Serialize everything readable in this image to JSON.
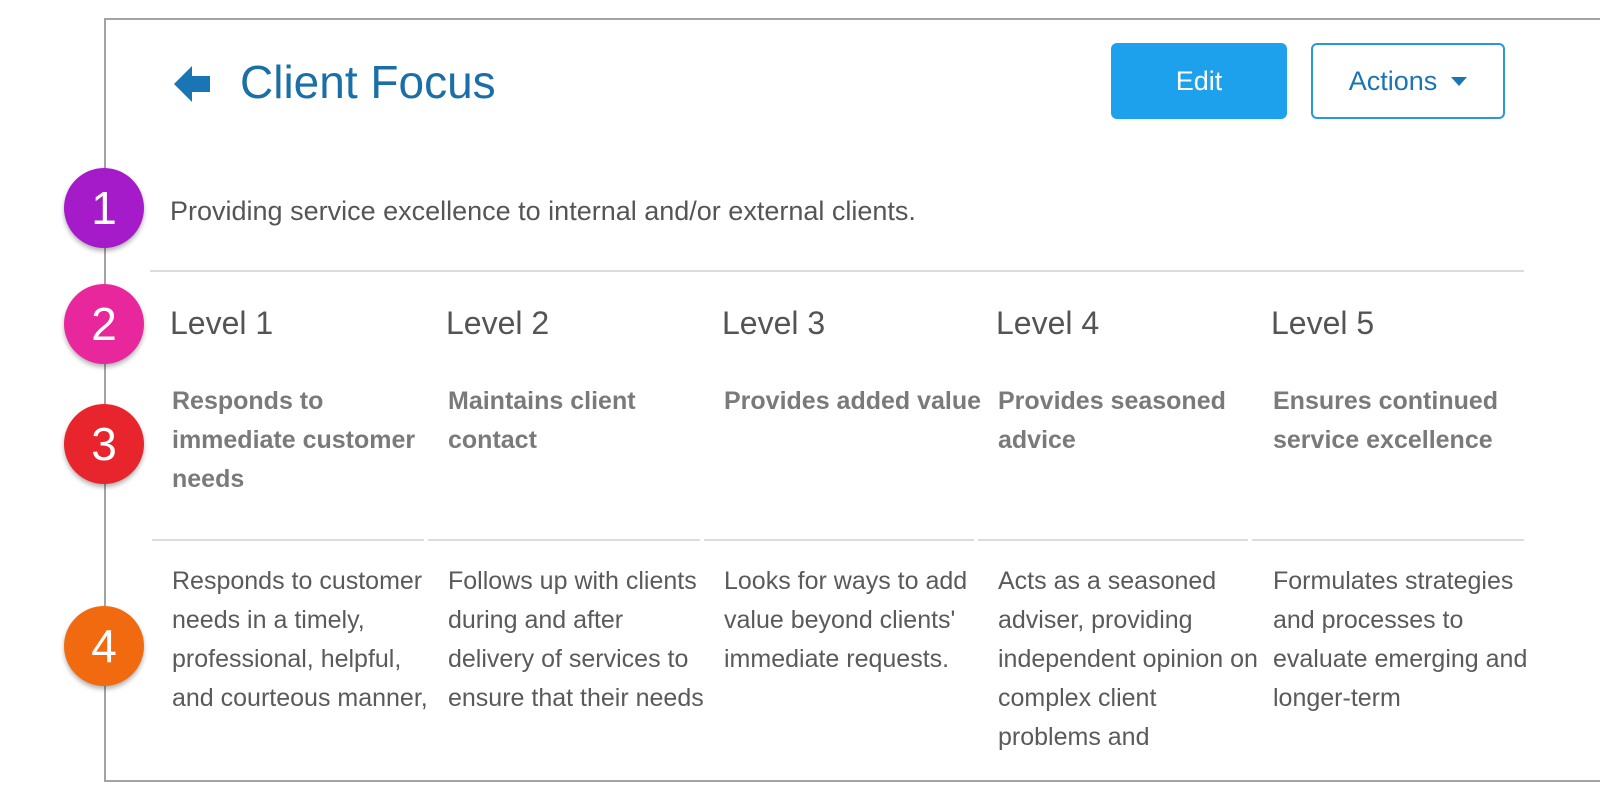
{
  "header": {
    "title": "Client Focus",
    "edit_label": "Edit",
    "actions_label": "Actions"
  },
  "description": "Providing service excellence to internal and/or external clients.",
  "levels": [
    {
      "label": "Level 1",
      "heading": "Responds to immediate customer needs",
      "body": "Responds to customer needs in a timely, professional, helpful, and courteous manner,"
    },
    {
      "label": "Level 2",
      "heading": "Maintains client contact",
      "body": "Follows up with clients during and after delivery of services to ensure that their needs"
    },
    {
      "label": "Level 3",
      "heading": "Provides added value",
      "body": "Looks for ways to add value beyond clients' immediate requests."
    },
    {
      "label": "Level 4",
      "heading": "Provides seasoned advice",
      "body": "Acts as a seasoned adviser, providing independent opinion on complex client problems and"
    },
    {
      "label": "Level 5",
      "heading": "Ensures continued service excellence",
      "body": "Formulates strategies and processes to evaluate emerging and longer-term"
    }
  ],
  "annotations": [
    {
      "number": "1",
      "color": "#a51bc9"
    },
    {
      "number": "2",
      "color": "#e9279c"
    },
    {
      "number": "3",
      "color": "#e8242c"
    },
    {
      "number": "4",
      "color": "#f26a10"
    }
  ],
  "icons": {
    "back": "arrow-left-icon",
    "actions_caret": "caret-down-icon"
  },
  "colors": {
    "accent": "#1ea1ec",
    "title": "#1a6fa6"
  }
}
